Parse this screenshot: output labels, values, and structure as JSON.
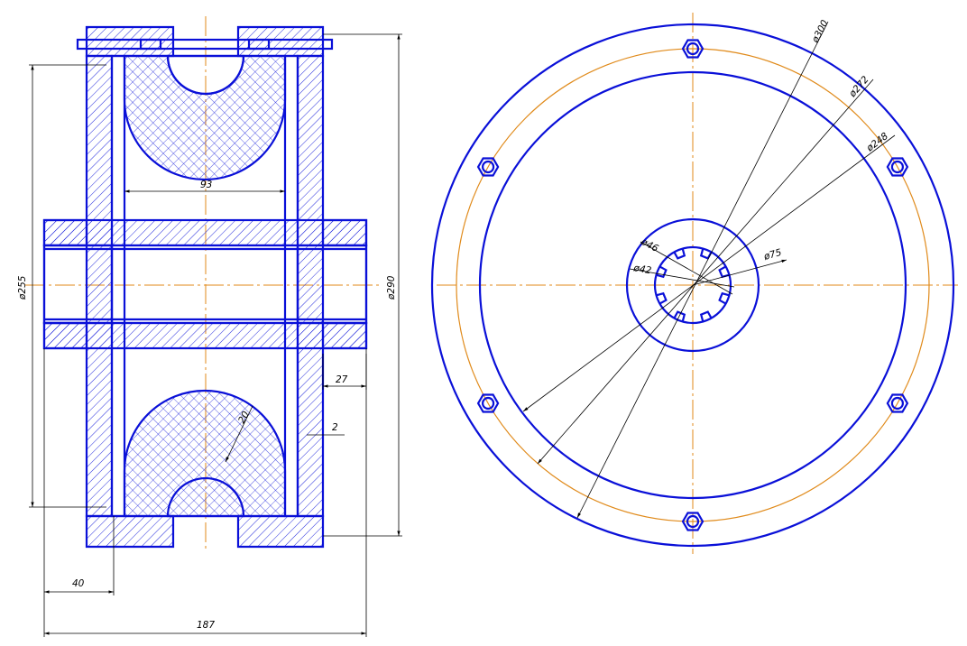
{
  "colors": {
    "outline": "#0a10d8",
    "centerline": "#e08a1a",
    "dimension": "#000000",
    "background": "#ffffff"
  },
  "section_view": {
    "dimensions": {
      "d255": "ø255",
      "d290": "ø290",
      "width_93": "93",
      "width_27": "27",
      "gap_2": "2",
      "radius_20": "20",
      "offset_40": "40",
      "length_187": "187"
    }
  },
  "front_view": {
    "bolt_count": 6,
    "dimensions": {
      "d300": "ø300",
      "d272": "ø272",
      "d248": "ø248",
      "d75": "ø75",
      "d46": "ø46",
      "d42": "ø42"
    }
  }
}
